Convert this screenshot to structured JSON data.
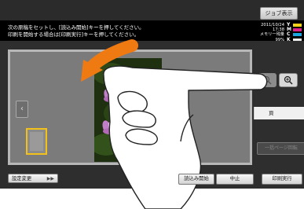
{
  "header": {
    "job_display_label": "ジョブ表示"
  },
  "message": {
    "line1": "次の原稿をセットし、[読込み開始]キーを押してください。",
    "line2": "印刷を開始する場合は[印刷実行]キーを押してください。"
  },
  "status": {
    "date": "2011/10/24",
    "time": "17:38",
    "memory": "メモリ一残量",
    "memory_value": "99%"
  },
  "toner": [
    {
      "label": "Y",
      "color": "#f4d21a"
    },
    {
      "label": "M",
      "color": "#e0218a"
    },
    {
      "label": "C",
      "color": "#1aa6e0"
    },
    {
      "label": "K",
      "color": "#222222"
    }
  ],
  "preview": {
    "nav_left_glyph": "‹",
    "zoom_out_icon": "zoom-out-icon",
    "zoom_in_icon": "zoom-in-icon"
  },
  "side": {
    "page_label": "頁",
    "page_disabled_label": "一括ページ回転"
  },
  "footer": {
    "settings_label": "設定変更",
    "settings_arrow": "▶▶",
    "scan_label": "読込み開始",
    "stop_label": "中止",
    "print_label": "印刷実行"
  },
  "colors": {
    "accent_arrow": "#f07a12",
    "thumb_highlight": "#f2c21b"
  }
}
